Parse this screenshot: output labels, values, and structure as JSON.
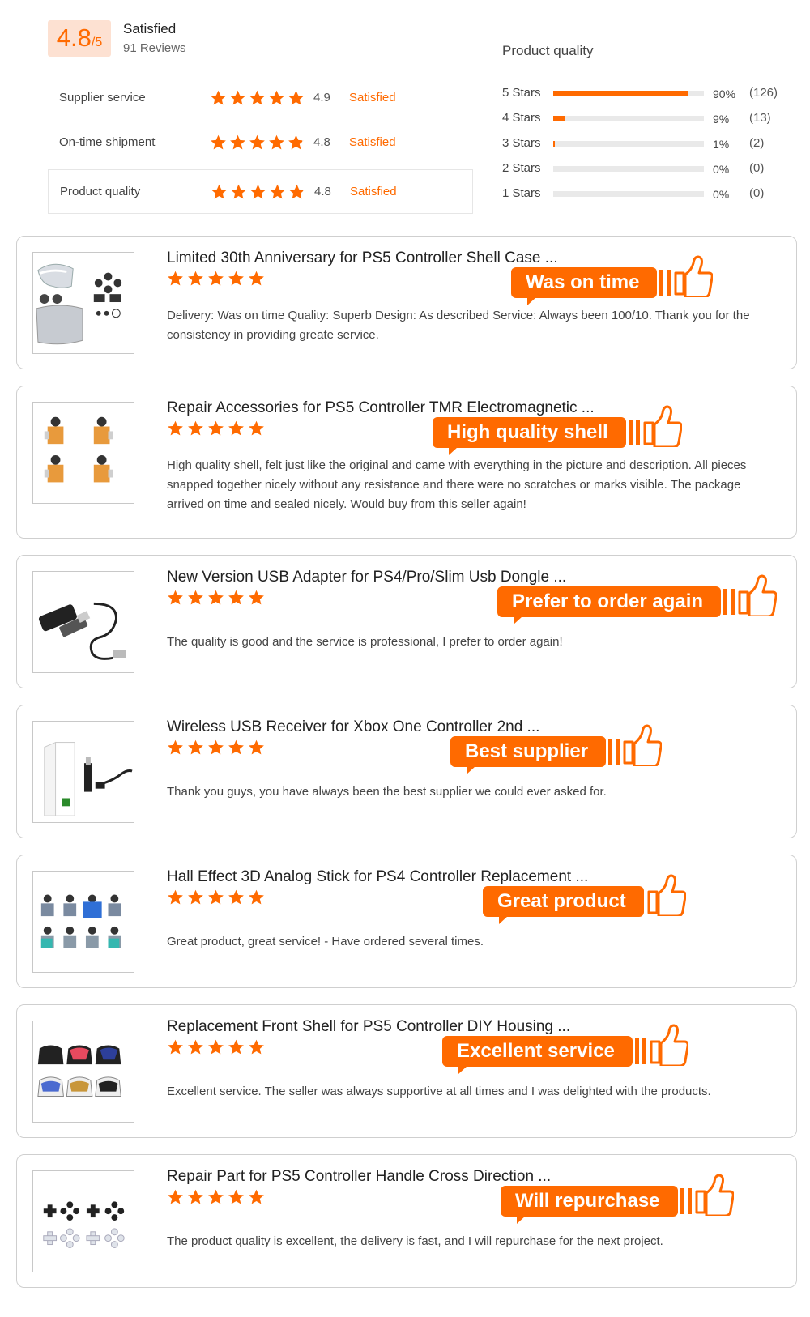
{
  "overall": {
    "score": "4.8",
    "out_of": "/5",
    "status": "Satisfied",
    "reviews": "91 Reviews"
  },
  "metrics": [
    {
      "name": "Supplier service",
      "score": "4.9",
      "status": "Satisfied",
      "stars": 5
    },
    {
      "name": "On-time shipment",
      "score": "4.8",
      "status": "Satisfied",
      "stars": 4.8
    },
    {
      "name": "Product quality",
      "score": "4.8",
      "status": "Satisfied",
      "stars": 4.8
    }
  ],
  "distribution": {
    "title": "Product quality",
    "rows": [
      {
        "label": "5 Stars",
        "percent": "90%",
        "count": "(126)",
        "fraction": 0.9
      },
      {
        "label": "4 Stars",
        "percent": "9%",
        "count": "(13)",
        "fraction": 0.08
      },
      {
        "label": "3 Stars",
        "percent": "1%",
        "count": "(2)",
        "fraction": 0.01
      },
      {
        "label": "2 Stars",
        "percent": "0%",
        "count": "(0)",
        "fraction": 0
      },
      {
        "label": "1 Stars",
        "percent": "0%",
        "count": "(0)",
        "fraction": 0
      }
    ]
  },
  "colors": {
    "accent": "#ff6a00",
    "badge_bg": "#fde1d2"
  },
  "reviews": [
    {
      "product": "Limited 30th Anniversary for PS5 Controller Shell Case ...",
      "tag": "Was on time",
      "text": "Delivery:  Was on time  Quality:  Superb Design:  As described Service:  Always been 100/10. Thank you for the consistency in providing greate service.",
      "rating": 5,
      "thumb_icon": "controller-shell-kit-icon"
    },
    {
      "product": "Repair Accessories for PS5 Controller TMR Electromagnetic ...",
      "tag": "High quality shell",
      "text": "High quality shell, felt just like the original and came with everything in the picture and description. All pieces snapped together nicely without any resistance and there were no scratches or marks visible. The package arrived on time and sealed nicely. Would buy from this seller again!",
      "rating": 5,
      "thumb_icon": "analog-stick-modules-icon"
    },
    {
      "product": "New Version USB Adapter for PS4/Pro/Slim Usb Dongle ...",
      "tag": "Prefer to order again",
      "text": "The quality is good and the service is professional, I prefer to order again!",
      "rating": 5,
      "thumb_icon": "usb-dongle-icon"
    },
    {
      "product": "Wireless USB Receiver for Xbox One Controller 2nd ...",
      "tag": "Best supplier",
      "text": "Thank you guys, you have always been the best supplier we could ever asked for.",
      "rating": 5,
      "thumb_icon": "usb-receiver-box-icon"
    },
    {
      "product": "Hall Effect 3D Analog Stick for PS4 Controller Replacement ...",
      "tag": "Great product",
      "text": "Great product, great service! - Have ordered several times.",
      "rating": 5,
      "thumb_icon": "hall-effect-sticks-icon"
    },
    {
      "product": "Replacement Front Shell for PS5 Controller DIY Housing ...",
      "tag": "Excellent service",
      "text": "Excellent service. The seller was always supportive at all times and I was delighted with the products.",
      "rating": 5,
      "thumb_icon": "front-shells-icon"
    },
    {
      "product": "Repair Part for PS5 Controller Handle Cross Direction ...",
      "tag": "Will repurchase",
      "text": "The product quality is excellent, the delivery is fast, and I will repurchase for the next project.",
      "rating": 5,
      "thumb_icon": "dpad-buttons-icon"
    }
  ]
}
